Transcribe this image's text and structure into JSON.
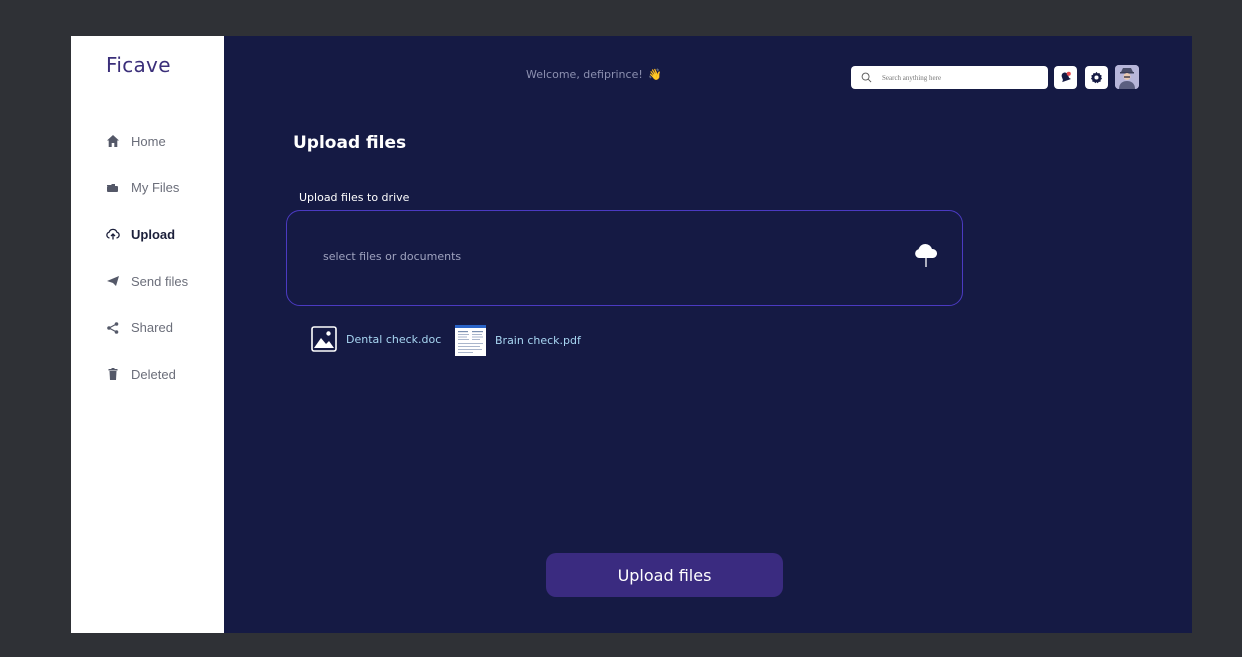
{
  "app": {
    "logo": "Ficave"
  },
  "sidebar": {
    "items": [
      {
        "label": "Home",
        "icon": "home-icon",
        "active": false
      },
      {
        "label": "My Files",
        "icon": "folder-icon",
        "active": false
      },
      {
        "label": "Upload",
        "icon": "cloud-upload-icon",
        "active": true
      },
      {
        "label": "Send files",
        "icon": "send-icon",
        "active": false
      },
      {
        "label": "Shared",
        "icon": "share-icon",
        "active": false
      },
      {
        "label": "Deleted",
        "icon": "trash-icon",
        "active": false
      }
    ]
  },
  "header": {
    "welcome": "Welcome, defiprince!",
    "wave": "👋",
    "search_placeholder": "Search anything here"
  },
  "main": {
    "title": "Upload files",
    "section_label": "Upload files to drive",
    "dropzone_text": "select files or documents",
    "files": [
      {
        "name": "Dental check.doc",
        "icon": "image-file-icon"
      },
      {
        "name": "Brain check.pdf",
        "icon": "document-file-icon"
      }
    ],
    "upload_button": "Upload files"
  },
  "colors": {
    "main_bg": "#151a44",
    "sidebar_bg": "#ffffff",
    "accent": "#3a2b80",
    "dropzone_border": "#4b3ac2",
    "file_link": "#a8d6f2"
  }
}
